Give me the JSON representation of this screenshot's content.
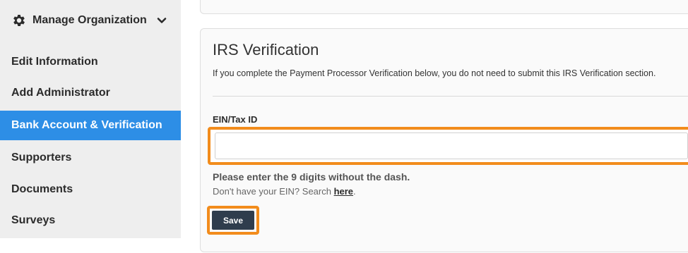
{
  "sidebar": {
    "header_label": "Manage Organization",
    "items": [
      {
        "label": "Edit Information",
        "active": false
      },
      {
        "label": "Add Administrator",
        "active": false
      },
      {
        "label": "Bank Account & Verification",
        "active": true
      },
      {
        "label": "Supporters",
        "active": false
      },
      {
        "label": "Documents",
        "active": false
      },
      {
        "label": "Surveys",
        "active": false
      }
    ]
  },
  "section": {
    "title": "IRS Verification",
    "subtitle": "If you complete the Payment Processor Verification below, you do not need to submit this IRS Verification section."
  },
  "form": {
    "ein_label": "EIN/Tax ID",
    "ein_value": "",
    "hint": "Please enter the 9 digits without the dash.",
    "help_prefix": "Don't have your EIN? Search ",
    "help_link": "here",
    "help_suffix": ".",
    "save_label": "Save"
  },
  "colors": {
    "accent_active": "#2d8ee6",
    "highlight": "#f28c1c",
    "button": "#2f3d4d"
  },
  "icons": {
    "header": "gear-icon",
    "header_toggle": "chevron-down-icon"
  }
}
